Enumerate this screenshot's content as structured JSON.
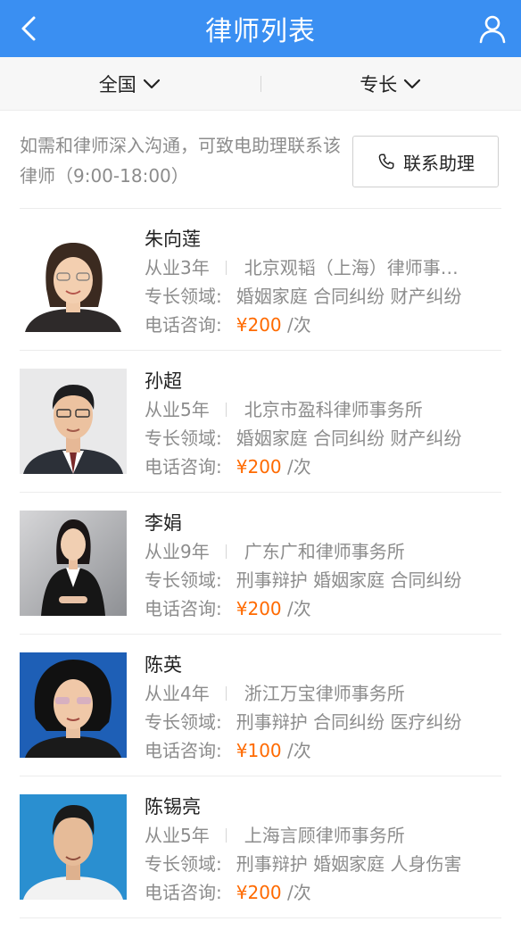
{
  "header": {
    "title": "律师列表",
    "back_icon": "chevron-left-icon",
    "user_icon": "user-icon"
  },
  "filters": {
    "region": "全国",
    "specialty": "专长"
  },
  "notice": {
    "text": "如需和律师深入沟通，可致电助理联系该律师（9:00-18:00）",
    "button_label": "联系助理"
  },
  "lawyers": [
    {
      "name": "朱向莲",
      "years": "从业3年",
      "firm": "北京观韬（上海）律师事…",
      "specialty_label": "专长领域:",
      "specialties": "婚姻家庭 合同纠纷 财产纠纷",
      "phone_label": "电话咨询:",
      "price": "¥200",
      "unit": "/次"
    },
    {
      "name": "孙超",
      "years": "从业5年",
      "firm": "北京市盈科律师事务所",
      "specialty_label": "专长领域:",
      "specialties": "婚姻家庭 合同纠纷 财产纠纷",
      "phone_label": "电话咨询:",
      "price": "¥200",
      "unit": "/次"
    },
    {
      "name": "李娟",
      "years": "从业9年",
      "firm": "广东广和律师事务所",
      "specialty_label": "专长领域:",
      "specialties": "刑事辩护 婚姻家庭 合同纠纷",
      "phone_label": "电话咨询:",
      "price": "¥200",
      "unit": "/次"
    },
    {
      "name": "陈英",
      "years": "从业4年",
      "firm": "浙江万宝律师事务所",
      "specialty_label": "专长领域:",
      "specialties": "刑事辩护 合同纠纷 医疗纠纷",
      "phone_label": "电话咨询:",
      "price": "¥100",
      "unit": "/次"
    },
    {
      "name": "陈锡亮",
      "years": "从业5年",
      "firm": "上海言顾律师事务所",
      "specialty_label": "专长领域:",
      "specialties": "刑事辩护 婚姻家庭 人身伤害",
      "phone_label": "电话咨询:",
      "price": "¥200",
      "unit": "/次"
    }
  ],
  "colors": {
    "header_bg": "#3a8ff2",
    "price": "#ff6a00",
    "muted_text": "#8c8c8c"
  }
}
